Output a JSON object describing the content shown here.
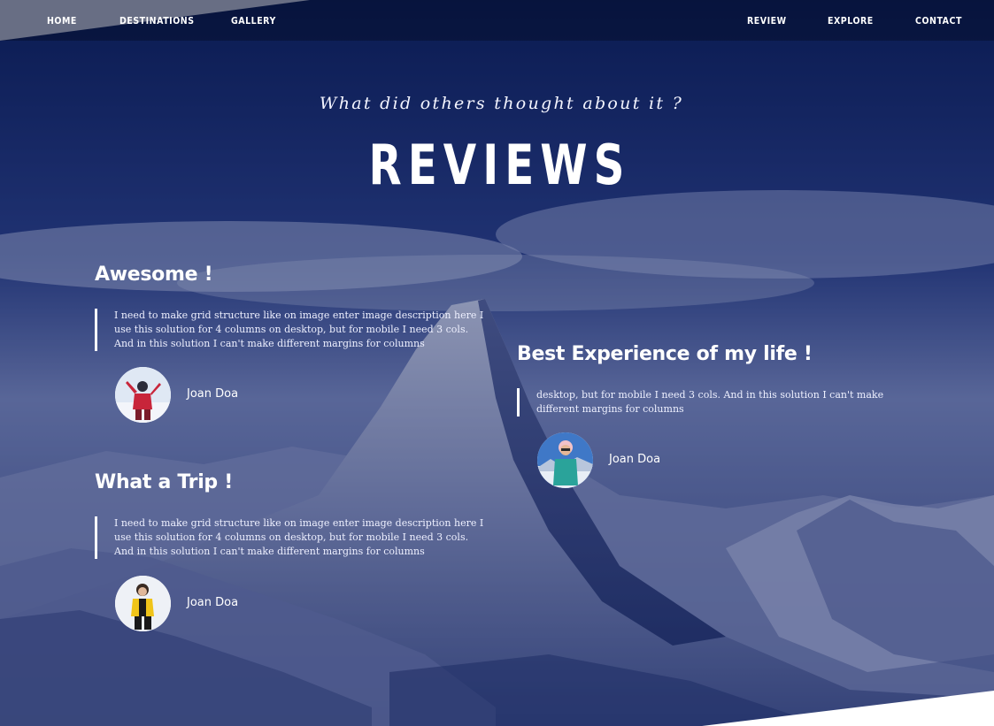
{
  "nav": {
    "left": [
      "HOME",
      "DESTINATIONS",
      "GALLERY"
    ],
    "right": [
      "REVIEW",
      "EXPLORE",
      "CONTACT"
    ]
  },
  "header": {
    "subtitle": "What did others thought about it ?",
    "title": "REVIEWS"
  },
  "reviews": [
    {
      "title": "Awesome !",
      "text": "I need to make grid structure like on image enter image description here I use this solution for 4 columns on desktop, but for mobile I need 3 cols. And in this solution I can't make different margins for columns",
      "author": "Joan Doa"
    },
    {
      "title": "What a Trip !",
      "text": "I need to make grid structure like on image enter image description here I use this solution for 4 columns on desktop, but for mobile I need 3 cols. And in this solution I can't make different margins for columns",
      "author": "Joan Doa"
    },
    {
      "title": "Best Experience of my life !",
      "text": "desktop, but for mobile I need 3 cols. And in this solution I can't make different margins for columns",
      "author": "Joan Doa"
    }
  ],
  "colors": {
    "overlay": "#0b1a4a",
    "text": "#ffffff",
    "accent_border": "#ffffff"
  }
}
